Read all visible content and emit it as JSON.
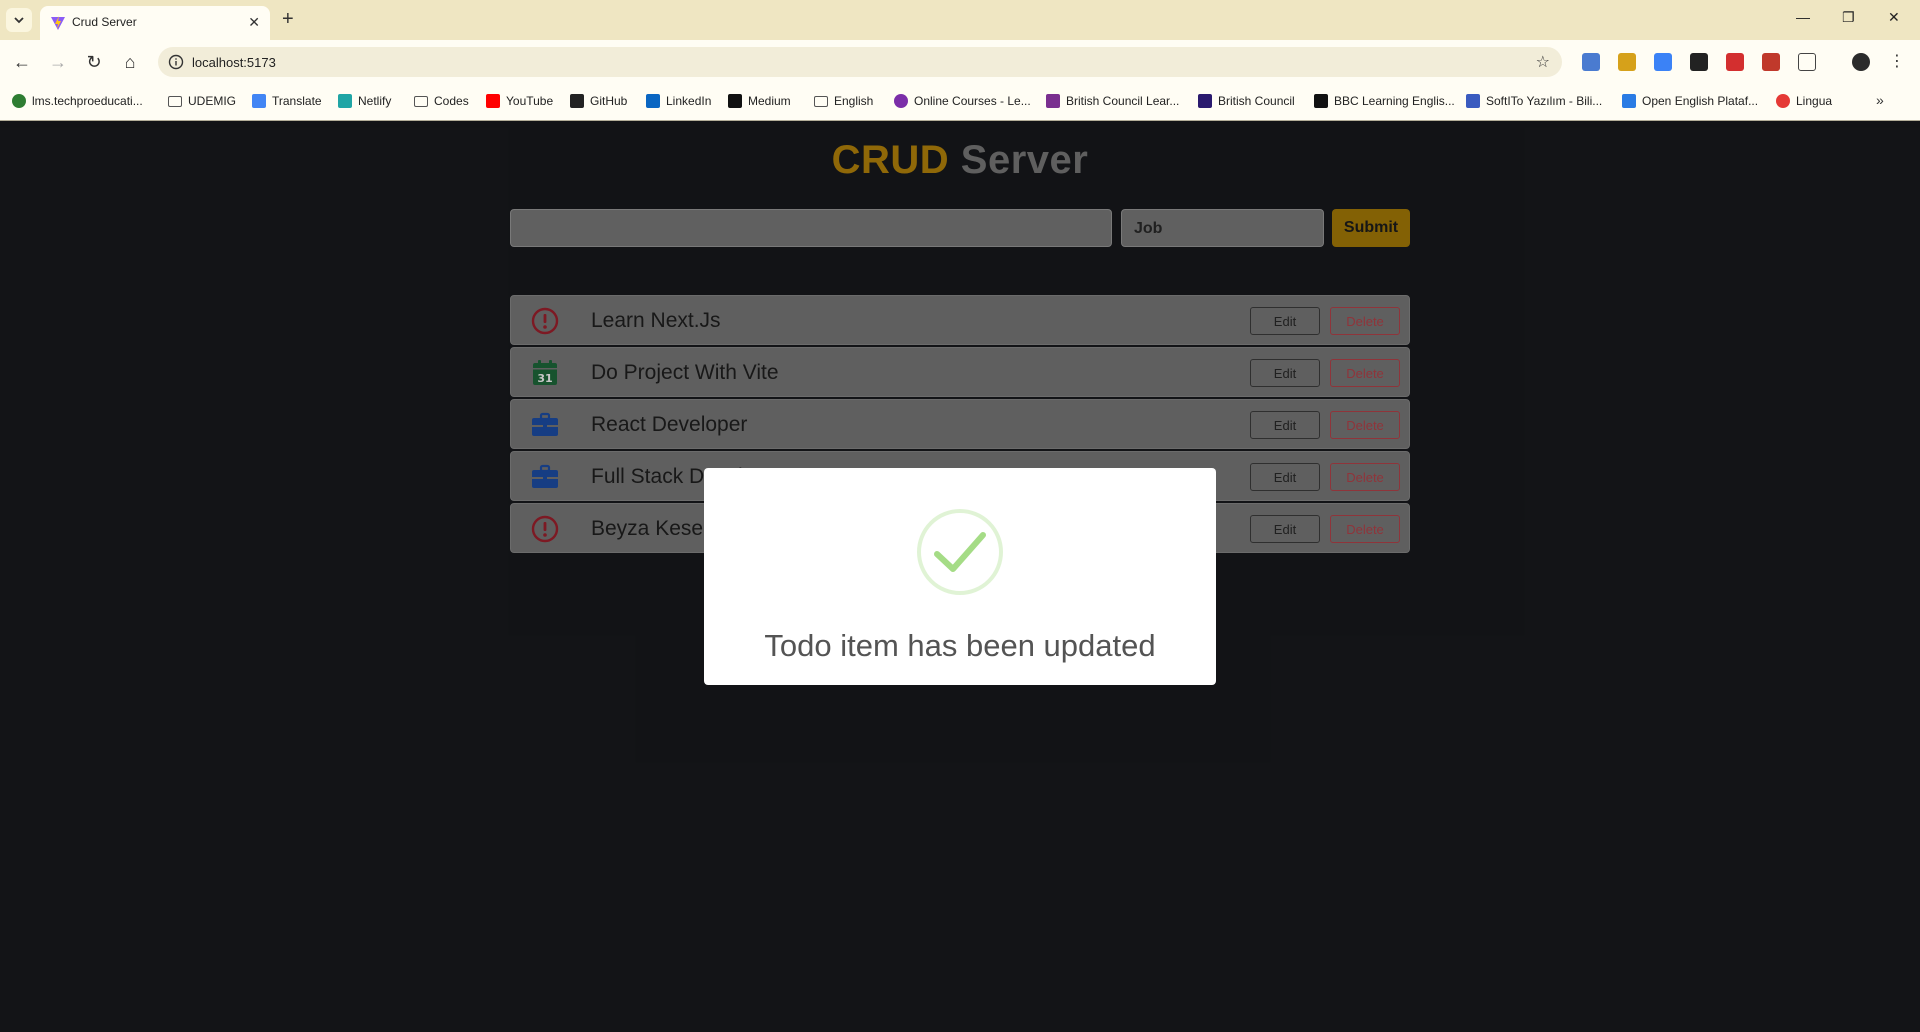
{
  "browser": {
    "tab_title": "Crud Server",
    "url": "localhost:5173",
    "bookmarks": [
      {
        "label": "lms.techproeducati...",
        "icon": "lms-icon",
        "color": "#2e7d32"
      },
      {
        "label": "UDEMIG",
        "icon": "folder-icon",
        "color": "#555555"
      },
      {
        "label": "Translate",
        "icon": "translate-icon",
        "color": "#4285f4"
      },
      {
        "label": "Netlify",
        "icon": "netlify-icon",
        "color": "#20a5a5"
      },
      {
        "label": "Codes",
        "icon": "folder-icon",
        "color": "#555555"
      },
      {
        "label": "YouTube",
        "icon": "youtube-icon",
        "color": "#ff0000"
      },
      {
        "label": "GitHub",
        "icon": "github-icon",
        "color": "#222222"
      },
      {
        "label": "LinkedIn",
        "icon": "linkedin-icon",
        "color": "#0a66c2"
      },
      {
        "label": "Medium",
        "icon": "medium-icon",
        "color": "#111111"
      },
      {
        "label": "English",
        "icon": "folder-icon",
        "color": "#555555"
      },
      {
        "label": "Online Courses - Le...",
        "icon": "online-courses-icon",
        "color": "#7b2ea8"
      },
      {
        "label": "British Council Lear...",
        "icon": "british-council-icon",
        "color": "#7a2f8f"
      },
      {
        "label": "British Council",
        "icon": "british-council-icon",
        "color": "#2a1a6e"
      },
      {
        "label": "BBC Learning Englis...",
        "icon": "bbc-icon",
        "color": "#111111"
      },
      {
        "label": "SoftITo Yazılım - Bili...",
        "icon": "softito-icon",
        "color": "#3a5bbf"
      },
      {
        "label": "Open English Plataf...",
        "icon": "open-english-icon",
        "color": "#2a7be4"
      },
      {
        "label": "Lingua",
        "icon": "lingua-icon",
        "color": "#e53935"
      }
    ]
  },
  "app": {
    "title_part1": "CRUD",
    "title_part2": "Server",
    "input": {
      "value": "",
      "placeholder": ""
    },
    "category_value": "Job",
    "submit_label": "Submit",
    "edit_label": "Edit",
    "delete_label": "Delete",
    "todos": [
      {
        "text": "Learn Next.Js",
        "icon": "exclamation-circle-icon"
      },
      {
        "text": "Do Project With Vite",
        "icon": "calendar-icon"
      },
      {
        "text": "React Developer",
        "icon": "briefcase-icon"
      },
      {
        "text": "Full Stack Developer",
        "icon": "briefcase-icon"
      },
      {
        "text": "Beyza Keser",
        "icon": "exclamation-circle-icon"
      }
    ],
    "calendar_day": "31"
  },
  "modal": {
    "message": "Todo item has been updated"
  },
  "colors": {
    "accent": "#b8860b",
    "submit": "#a87d07",
    "danger": "#b8434b",
    "page_bg": "#18191d",
    "check": "#a5dc86"
  }
}
